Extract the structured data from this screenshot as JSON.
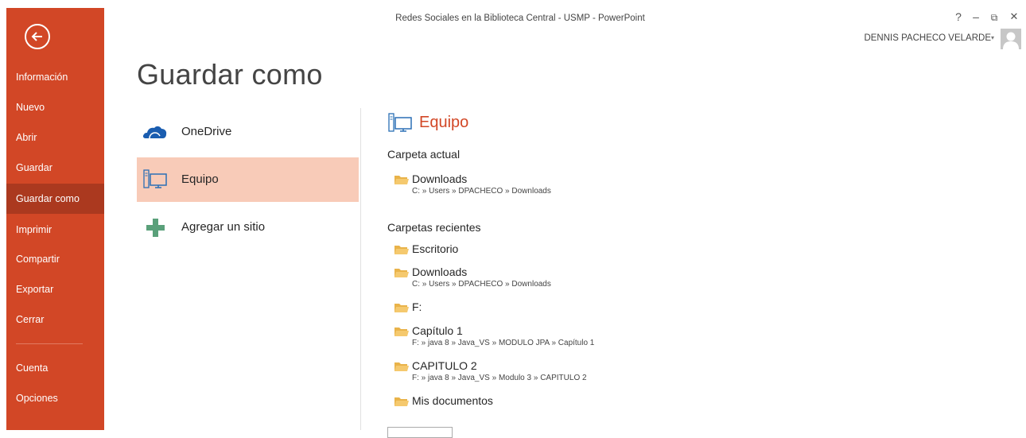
{
  "window": {
    "title": "Redes Sociales en la Biblioteca Central - USMP - PowerPoint",
    "help": "?",
    "minimize": "–",
    "restore": "⧉",
    "close": "✕"
  },
  "user": {
    "name": "DENNIS PACHECO VELARDE",
    "caret": "▾"
  },
  "nav": {
    "items": [
      {
        "label": "Información"
      },
      {
        "label": "Nuevo"
      },
      {
        "label": "Abrir"
      },
      {
        "label": "Guardar"
      },
      {
        "label": "Guardar como",
        "active": true
      },
      {
        "label": "Imprimir"
      },
      {
        "label": "Compartir"
      },
      {
        "label": "Exportar"
      },
      {
        "label": "Cerrar"
      },
      {
        "label": "Cuenta"
      },
      {
        "label": "Opciones"
      }
    ]
  },
  "page": {
    "title": "Guardar como"
  },
  "places": [
    {
      "label": "OneDrive",
      "icon": "cloud-icon"
    },
    {
      "label": "Equipo",
      "icon": "computer-icon",
      "selected": true
    },
    {
      "label": "Agregar un sitio",
      "icon": "plus-icon"
    }
  ],
  "pane": {
    "title": "Equipo",
    "current_heading": "Carpeta actual",
    "current": {
      "name": "Downloads",
      "path": "C: » Users » DPACHECO » Downloads"
    },
    "recent_heading": "Carpetas recientes",
    "recent": [
      {
        "name": "Escritorio",
        "path": ""
      },
      {
        "name": "Downloads",
        "path": "C: » Users » DPACHECO » Downloads"
      },
      {
        "name": "F:",
        "path": ""
      },
      {
        "name": "Capítulo 1",
        "path": "F: » java 8 » Java_VS » MODULO JPA » Capítulo 1"
      },
      {
        "name": "CAPITULO 2",
        "path": "F: » java 8 » Java_VS » Modulo 3 » CAPITULO 2"
      },
      {
        "name": "Mis documentos",
        "path": ""
      }
    ]
  },
  "colors": {
    "accent": "#d24726",
    "nav_active": "#ab391f",
    "selected_place": "#f8cbb8",
    "folder": "#f5c46a"
  }
}
